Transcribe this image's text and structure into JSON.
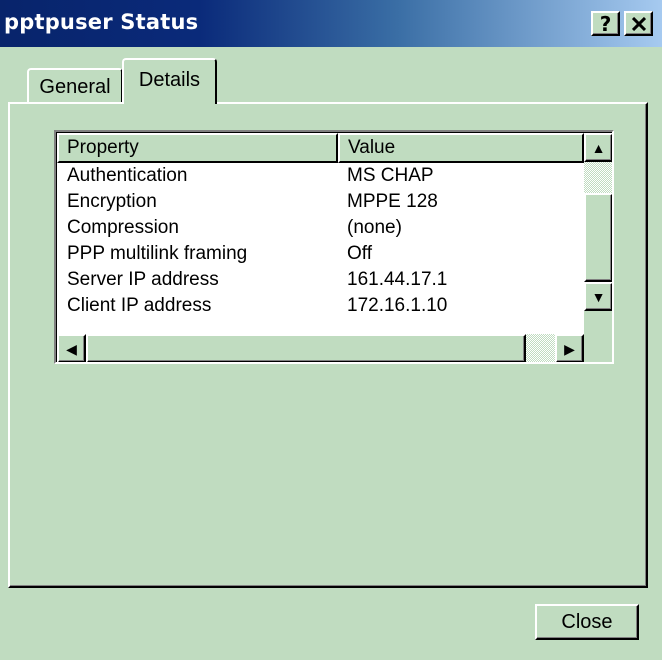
{
  "window": {
    "title": "pptpuser Status",
    "help_label": "?",
    "close_label": "✕"
  },
  "tabs": [
    {
      "label": "General",
      "selected": false
    },
    {
      "label": "Details",
      "selected": true
    }
  ],
  "details_list": {
    "columns": [
      "Property",
      "Value"
    ],
    "rows": [
      {
        "property": "Authentication",
        "value": "MS CHAP"
      },
      {
        "property": "Encryption",
        "value": "MPPE 128"
      },
      {
        "property": "Compression",
        "value": "(none)"
      },
      {
        "property": "PPP multilink framing",
        "value": "Off"
      },
      {
        "property": "Server IP address",
        "value": "161.44.17.1"
      },
      {
        "property": "Client IP address",
        "value": "172.16.1.10"
      }
    ]
  },
  "footer": {
    "close_button_label": "Close"
  },
  "icons": {
    "up_arrow": "▲",
    "down_arrow": "▼",
    "left_arrow": "◀",
    "right_arrow": "▶"
  },
  "colors": {
    "titlebar_start": "#08246b",
    "titlebar_end": "#a6caf0",
    "face": "#c0dcc0"
  }
}
